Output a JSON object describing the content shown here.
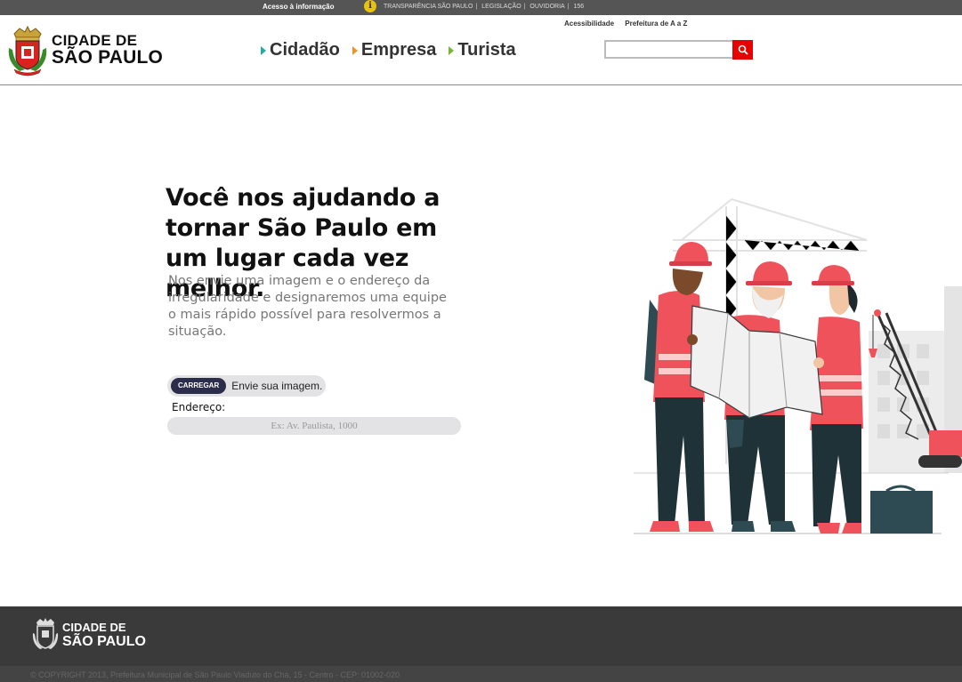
{
  "topbar": {
    "acesso": "Acesso à informação",
    "links": [
      "TRANSPARÊNCIA SÃO PAULO",
      "LEGISLAÇÃO",
      "OUVIDORIA",
      "156"
    ]
  },
  "header": {
    "logo_line1": "CIDADE DE",
    "logo_line2": "SÃO PAULO",
    "nav": [
      "Cidadão",
      "Empresa",
      "Turista"
    ],
    "accessibility": "Acessibilidade",
    "prefeitura_az": "Prefeitura de A a Z",
    "search_placeholder": ""
  },
  "main": {
    "headline": "Você nos ajudando a tornar São Paulo em um lugar cada vez melhor.",
    "subtext": "Nos envie uma imagem e o endereço da irregularidade e designaremos uma equipe o mais rápido possível para resolvermos a situação.",
    "upload_button": "CARREGAR",
    "upload_label": "Envie sua imagem.",
    "address_label": "Endereço:",
    "address_placeholder": "Ex: Av. Paulista, 1000"
  },
  "footer": {
    "logo_line1": "CIDADE DE",
    "logo_line2": "SÃO PAULO",
    "copyright": "© COPYRIGHT 2013, Prefeitura Municipal de São Paulo Viaduto do Chá, 15 - Centro - CEP: 01002-020"
  },
  "colors": {
    "accent": "#e60000",
    "topbar": "#555555",
    "footer": "#3a3a3a",
    "upload_button": "#2b2d4b",
    "worker_red": "#f0525c"
  }
}
